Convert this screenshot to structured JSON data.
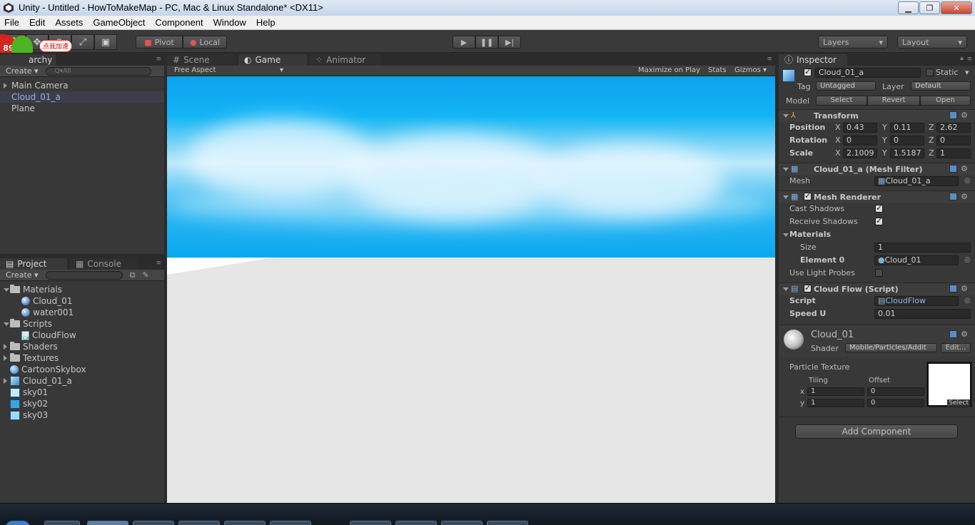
{
  "window": {
    "title": "Unity - Untitled - HowToMakeMap - PC, Mac & Linux Standalone* <DX11>"
  },
  "menu": [
    "File",
    "Edit",
    "Assets",
    "GameObject",
    "Component",
    "Window",
    "Help"
  ],
  "toolbar": {
    "pivot_label": "Pivot",
    "local_label": "Local",
    "layers_label": "Layers",
    "layout_label": "Layout",
    "badge_number": "89",
    "speed_label": "点我加速"
  },
  "hierarchy": {
    "tab_label": "archy",
    "create_label": "Create",
    "search_placeholder": "Q▾All",
    "items": [
      "Main Camera",
      "Cloud_01_a",
      "Plane"
    ]
  },
  "center_tabs": [
    "Scene",
    "Game",
    "Animator"
  ],
  "game": {
    "aspect": "Free Aspect",
    "maximize": "Maximize on Play",
    "stats": "Stats",
    "gizmos": "Gizmos"
  },
  "project": {
    "tabs": [
      "Project",
      "Console"
    ],
    "create_label": "Create",
    "items": [
      {
        "label": "Materials",
        "icon": "folder-icon",
        "indent": 0,
        "open": true
      },
      {
        "label": "Cloud_01",
        "icon": "material-icon",
        "indent": 1
      },
      {
        "label": "water001",
        "icon": "material-icon",
        "indent": 1
      },
      {
        "label": "Scripts",
        "icon": "folder-icon",
        "indent": 0,
        "open": true
      },
      {
        "label": "CloudFlow",
        "icon": "script-icon",
        "indent": 1
      },
      {
        "label": "Shaders",
        "icon": "folder-icon",
        "indent": 0
      },
      {
        "label": "Textures",
        "icon": "folder-icon",
        "indent": 0
      },
      {
        "label": "CartoonSkybox",
        "icon": "skybox-icon",
        "indent": 0
      },
      {
        "label": "Cloud_01_a",
        "icon": "prefab-icon",
        "indent": 0
      },
      {
        "label": "sky01",
        "icon": "texture-icon",
        "indent": 0
      },
      {
        "label": "sky02",
        "icon": "texture-icon",
        "indent": 0
      },
      {
        "label": "sky03",
        "icon": "texture-icon",
        "indent": 0
      }
    ]
  },
  "inspector": {
    "tab_label": "Inspector",
    "object_name": "Cloud_01_a",
    "static_label": "Static",
    "tag_label": "Tag",
    "tag_value": "Untagged",
    "layer_label": "Layer",
    "layer_value": "Default",
    "model_label": "Model",
    "model_buttons": [
      "Select",
      "Revert",
      "Open"
    ],
    "transform": {
      "title": "Transform",
      "rows": [
        {
          "label": "Position",
          "x": "0.43",
          "y": "0.11",
          "z": "2.62"
        },
        {
          "label": "Rotation",
          "x": "0",
          "y": "0",
          "z": "0"
        },
        {
          "label": "Scale",
          "x": "2.1009",
          "y": "1.5187",
          "z": "1"
        }
      ]
    },
    "mesh_filter": {
      "title": "Cloud_01_a (Mesh Filter)",
      "mesh_label": "Mesh",
      "mesh_value": "Cloud_01_a"
    },
    "mesh_renderer": {
      "title": "Mesh Renderer",
      "cast_shadows": "Cast Shadows",
      "receive_shadows": "Receive Shadows",
      "materials": "Materials",
      "size_label": "Size",
      "size_value": "1",
      "element_label": "Element 0",
      "element_value": "Cloud_01",
      "light_probes": "Use Light Probes"
    },
    "script": {
      "title": "Cloud Flow (Script)",
      "script_label": "Script",
      "script_value": "CloudFlow",
      "speed_label": "Speed U",
      "speed_value": "0.01"
    },
    "material": {
      "name": "Cloud_01",
      "shader_label": "Shader",
      "shader_value": "Mobile/Particles/Addit",
      "edit_label": "Edit...",
      "texture_label": "Particle Texture",
      "tiling_label": "Tiling",
      "offset_label": "Offset",
      "tiling_x": "1",
      "tiling_y": "1",
      "offset_x": "0",
      "offset_y": "0",
      "select_label": "Select"
    },
    "add_component": "Add Component"
  },
  "colors": {
    "selection_text": "#8fb6e8",
    "sky": "#12b5f5",
    "ground": "#e6e6e6"
  }
}
